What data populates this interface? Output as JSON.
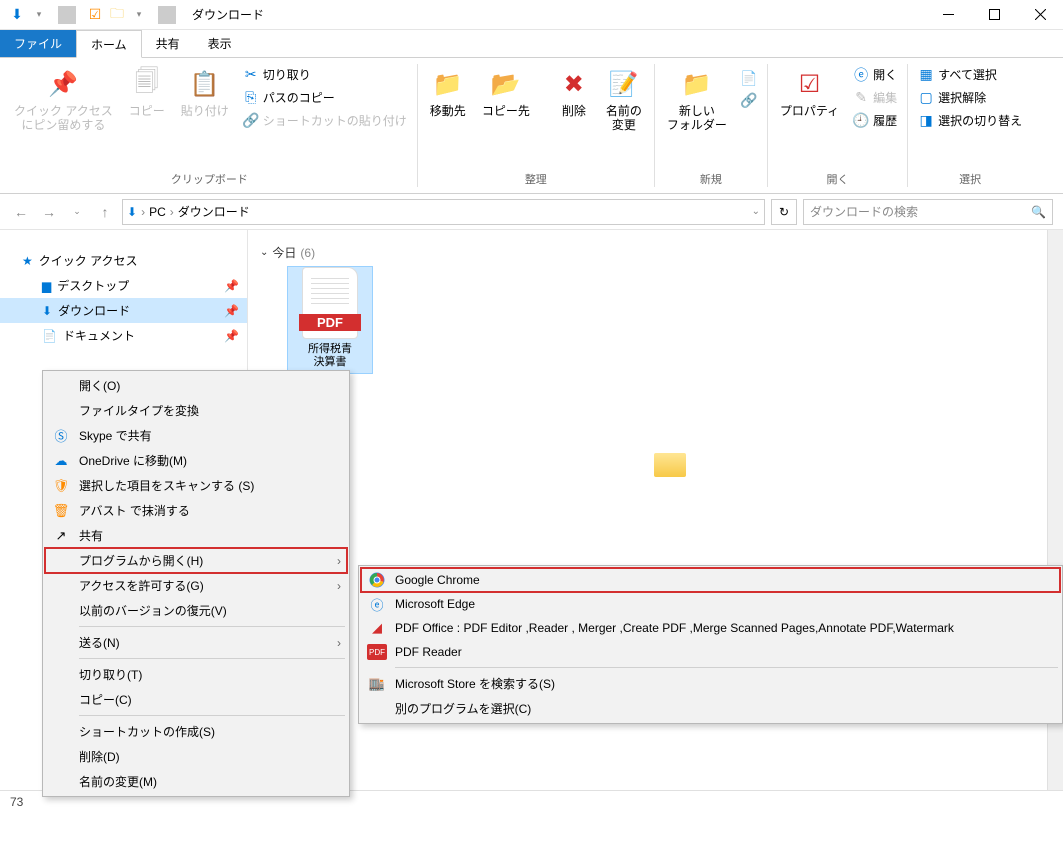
{
  "window": {
    "title": "ダウンロード"
  },
  "tabs": {
    "file": "ファイル",
    "home": "ホーム",
    "share": "共有",
    "view": "表示"
  },
  "ribbon": {
    "clipboard": {
      "pin": "クイック アクセス\nにピン留めする",
      "copy": "コピー",
      "paste": "貼り付け",
      "cut": "切り取り",
      "copy_path": "パスのコピー",
      "paste_shortcut": "ショートカットの貼り付け",
      "group": "クリップボード"
    },
    "organize": {
      "move_to": "移動先",
      "copy_to": "コピー先",
      "delete": "削除",
      "rename": "名前の\n変更",
      "group": "整理"
    },
    "new": {
      "new_folder": "新しい\nフォルダー",
      "group": "新規"
    },
    "open": {
      "properties": "プロパティ",
      "open_btn": "開く",
      "edit": "編集",
      "history": "履歴",
      "group": "開く"
    },
    "select": {
      "select_all": "すべて選択",
      "select_none": "選択解除",
      "invert": "選択の切り替え",
      "group": "選択"
    }
  },
  "breadcrumb": {
    "pc": "PC",
    "downloads": "ダウンロード"
  },
  "search": {
    "placeholder": "ダウンロードの検索"
  },
  "nav": {
    "quick_access": "クイック アクセス",
    "desktop": "デスクトップ",
    "downloads": "ダウンロード",
    "documents": "ドキュメント"
  },
  "content": {
    "group_today": "今日",
    "group_count": "(6)",
    "file1_label": "所得税青\n決算書"
  },
  "context1": {
    "open": "開く(O)",
    "change_type": "ファイルタイプを変換",
    "skype": "Skype で共有",
    "onedrive": "OneDrive に移動(M)",
    "scan": "選択した項目をスキャンする (S)",
    "avast": "アバスト で抹消する",
    "share": "共有",
    "open_with": "プログラムから開く(H)",
    "grant_access": "アクセスを許可する(G)",
    "restore": "以前のバージョンの復元(V)",
    "send_to": "送る(N)",
    "cut": "切り取り(T)",
    "copy": "コピー(C)",
    "shortcut": "ショートカットの作成(S)",
    "delete": "削除(D)",
    "rename": "名前の変更(M)"
  },
  "context2": {
    "chrome": "Google Chrome",
    "edge": "Microsoft Edge",
    "pdf_office": "PDF Office : PDF Editor ,Reader , Merger ,Create PDF ,Merge Scanned Pages,Annotate PDF,Watermark",
    "pdf_reader": "PDF Reader",
    "ms_store": "Microsoft Store を検索する(S)",
    "other": "別のプログラムを選択(C)"
  },
  "status": {
    "count_prefix": "73"
  }
}
